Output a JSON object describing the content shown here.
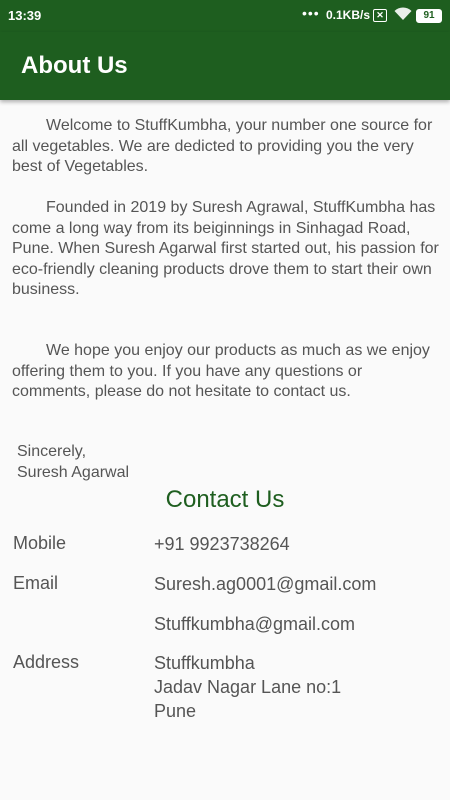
{
  "status_bar": {
    "time": "13:39",
    "dots": "•••",
    "speed": "0.1KB/s",
    "data_icon_text": "✕",
    "battery": "91"
  },
  "app_bar": {
    "title": "About Us"
  },
  "about": {
    "paragraph1": "Welcome to StuffKumbha, your number one source for all vegetables. We are dedicted to providing you the very best of Vegetables.",
    "paragraph2": "Founded in 2019 by Suresh Agrawal, StuffKumbha has come a long way from its beiginnings in Sinhagad Road, Pune. When Suresh Agarwal first started out, his passion for eco-friendly cleaning products drove them to start their own business.",
    "paragraph3": "We hope you enjoy our products as much as we enjoy offering them to you. If you have any questions or comments, please do not hesitate to contact us.",
    "signoff": "Sincerely,",
    "signature": "Suresh Agarwal"
  },
  "contact": {
    "heading": "Contact Us",
    "mobile_label": "Mobile",
    "mobile_value": "+91 9923738264",
    "email_label": "Email",
    "email_value_1": "Suresh.ag0001@gmail.com",
    "email_value_2": "Stuffkumbha@gmail.com",
    "address_label": "Address",
    "address_lines": [
      "Stuffkumbha",
      "Jadav Nagar Lane no:1",
      "Pune"
    ]
  },
  "colors": {
    "primary": "#1e5e1f",
    "text": "#555555",
    "background": "#fafafa"
  }
}
